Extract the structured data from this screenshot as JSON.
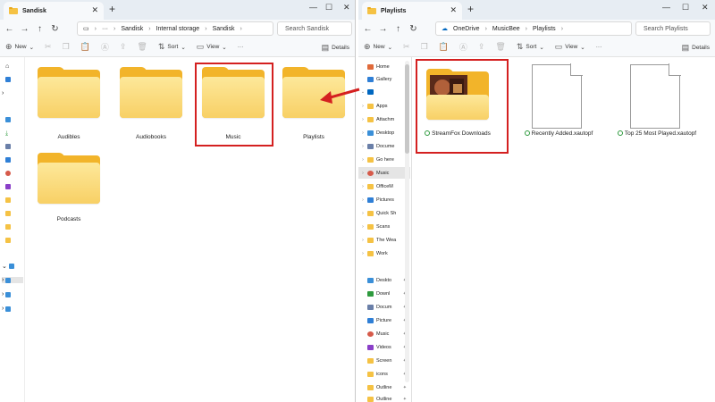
{
  "left": {
    "tab_title": "Sandisk",
    "breadcrumb": [
      "Sandisk",
      "Internal storage",
      "Sandisk"
    ],
    "search_placeholder": "Search Sandisk",
    "toolbar": {
      "new": "New",
      "sort": "Sort",
      "view": "View",
      "more": "···",
      "details": "Details"
    },
    "folders": [
      "Audibles",
      "Audiobooks",
      "Music",
      "Playlists",
      "Podcasts"
    ]
  },
  "right": {
    "tab_title": "Playlists",
    "breadcrumb": [
      "OneDrive",
      "MusicBee",
      "Playlists"
    ],
    "search_placeholder": "Search Playlists",
    "toolbar": {
      "new": "New",
      "sort": "Sort",
      "view": "View",
      "more": "···",
      "details": "Details"
    },
    "nav_items": [
      "Home",
      "Gallery",
      "Apps",
      "Attachm",
      "Desktop",
      "Docume",
      "Go here",
      "Music",
      "OfficeM",
      "Pictures",
      "Quick Sh",
      "Scans",
      "The Wea",
      "Work",
      "Deskto",
      "Downl",
      "Docum",
      "Picture",
      "Music",
      "Videos",
      "Screen",
      "icons",
      "Outline",
      "Outline"
    ],
    "items": [
      "StreamFox Downloads",
      "Recently Added.xautopf",
      "Top 25 Most Played.xautopf"
    ]
  },
  "colors": {
    "highlight": "#d42020",
    "folder": "#f8d065",
    "accent": "#0067c0"
  }
}
